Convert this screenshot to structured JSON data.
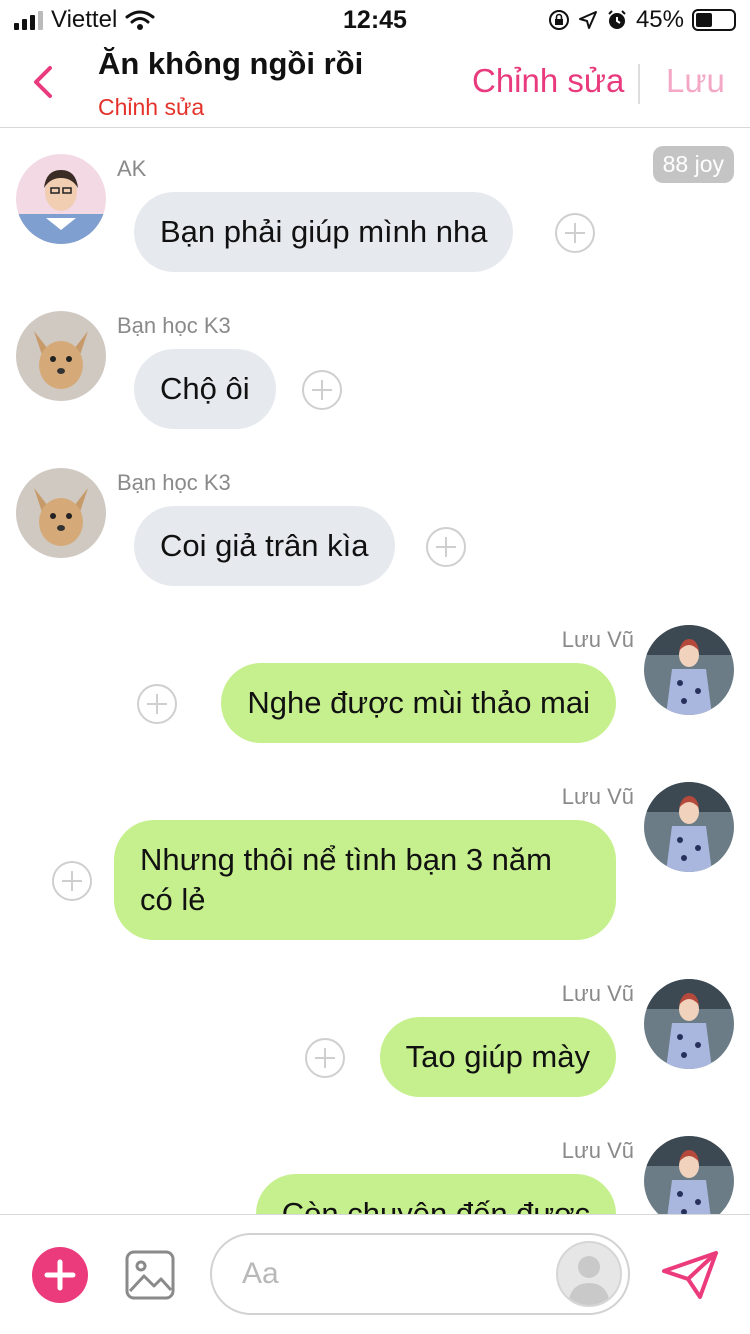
{
  "status_bar": {
    "carrier": "Viettel",
    "time": "12:45",
    "battery_text": "45%",
    "battery_level": 0.45
  },
  "header": {
    "title": "Ăn không ngồi rồi",
    "subtitle": "Chỉnh sửa",
    "edit_label": "Chỉnh sửa",
    "save_label": "Lưu"
  },
  "chat": {
    "badge": "88 joy",
    "messages": [
      {
        "sender": "AK",
        "text": "Bạn phải giúp mình nha",
        "direction": "incoming"
      },
      {
        "sender": "Bạn học K3",
        "text": "Chộ ôi",
        "direction": "incoming"
      },
      {
        "sender": "Bạn học K3",
        "text": "Coi giả trân kìa",
        "direction": "incoming"
      },
      {
        "sender": "Lưu Vũ",
        "text": "Nghe được mùi thảo mai",
        "direction": "outgoing"
      },
      {
        "sender": "Lưu Vũ",
        "text_line1": "Nhưng thôi nể tình bạn 3 năm",
        "text_line2": "có lẻ",
        "direction": "outgoing"
      },
      {
        "sender": "Lưu Vũ",
        "text": "Tao giúp mày",
        "direction": "outgoing"
      },
      {
        "sender": "Lưu Vũ",
        "text": "Còn chuyện đến được",
        "direction": "outgoing"
      }
    ]
  },
  "input": {
    "placeholder": "Aa"
  },
  "colors": {
    "accent": "#ec3b7d",
    "outgoing_bubble": "#c6f08d",
    "incoming_bubble": "#e6e9ee",
    "subtitle_red": "#e4322b"
  },
  "icons": {
    "back": "chevron-left-icon",
    "react": "plus-circle-icon",
    "add": "plus-icon",
    "gallery": "image-icon",
    "sticker": "avatar-silhouette-icon",
    "send": "send-icon"
  }
}
